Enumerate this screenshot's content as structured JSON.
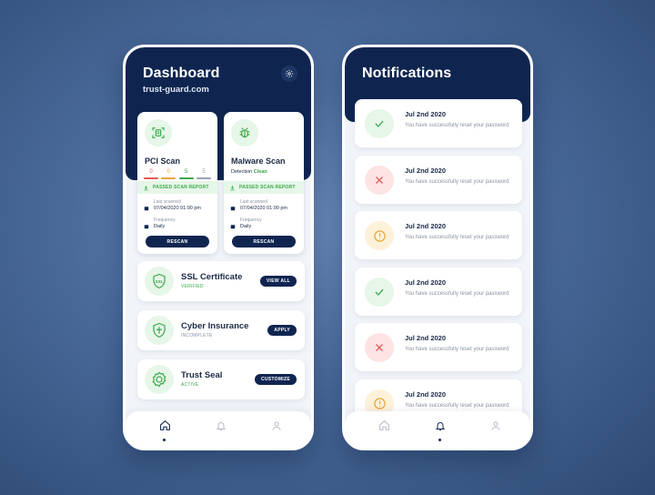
{
  "colors": {
    "navy": "#0f2550",
    "green": "#3aa94a",
    "green_bg": "#e6f6e8",
    "red_bg": "#fde3e3",
    "red": "#e05a5a",
    "amber_bg": "#fdf1da",
    "amber": "#e8a737"
  },
  "dashboard": {
    "title": "Dashboard",
    "subtitle": "trust-guard.com",
    "settings_icon": "gear-icon",
    "pci_scan": {
      "title": "PCI Scan",
      "icon": "scan-icon",
      "scores": [
        {
          "value": "0",
          "color": "#e05a5a"
        },
        {
          "value": "0",
          "color": "#e8a737"
        },
        {
          "value": "5",
          "color": "#3aa94a"
        },
        {
          "value": "5",
          "color": "#9aa3b2"
        }
      ],
      "passed_label": "PASSED SCAN REPORT",
      "last_scanned_label": "Last scanned",
      "last_scanned_value": "07/04/2020   01:00 pm",
      "frequency_label": "Frequency",
      "frequency_value": "Daily",
      "button": "RESCAN"
    },
    "malware_scan": {
      "title": "Malware Scan",
      "icon": "bug-icon",
      "detection_label": "Detection",
      "detection_value": "Clean",
      "passed_label": "PASSED SCAN REPORT",
      "last_scanned_label": "Last scanned",
      "last_scanned_value": "07/04/2020   01:00 pm",
      "frequency_label": "Frequency",
      "frequency_value": "Daily",
      "button": "RESCAN"
    },
    "services": [
      {
        "title": "SSL Certificate",
        "status": "VERIFIED",
        "status_color": "#3aa94a",
        "button": "VIEW ALL",
        "icon": "ssl-badge-icon"
      },
      {
        "title": "Cyber Insurance",
        "status": "INCOMPLETE",
        "status_color": "#8892a3",
        "button": "APPLY",
        "icon": "shield-icon"
      },
      {
        "title": "Trust Seal",
        "status": "ACTIVE",
        "status_color": "#3aa94a",
        "button": "CUSTOMIZE",
        "icon": "seal-icon"
      }
    ],
    "nav": {
      "active": "home"
    }
  },
  "notifications": {
    "title": "Notifications",
    "items": [
      {
        "date": "Jul 2nd 2020",
        "message": "You have successfully reset your password",
        "type": "success"
      },
      {
        "date": "Jul 2nd 2020",
        "message": "You have successfully reset your password",
        "type": "error"
      },
      {
        "date": "Jul 2nd 2020",
        "message": "You have successfully reset your password",
        "type": "warning"
      },
      {
        "date": "Jul 2nd 2020",
        "message": "You have successfully reset your password",
        "type": "success"
      },
      {
        "date": "Jul 2nd 2020",
        "message": "You have successfully reset your password",
        "type": "error"
      },
      {
        "date": "Jul 2nd 2020",
        "message": "You have successfully reset your password",
        "type": "warning"
      }
    ],
    "nav": {
      "active": "bell"
    }
  }
}
